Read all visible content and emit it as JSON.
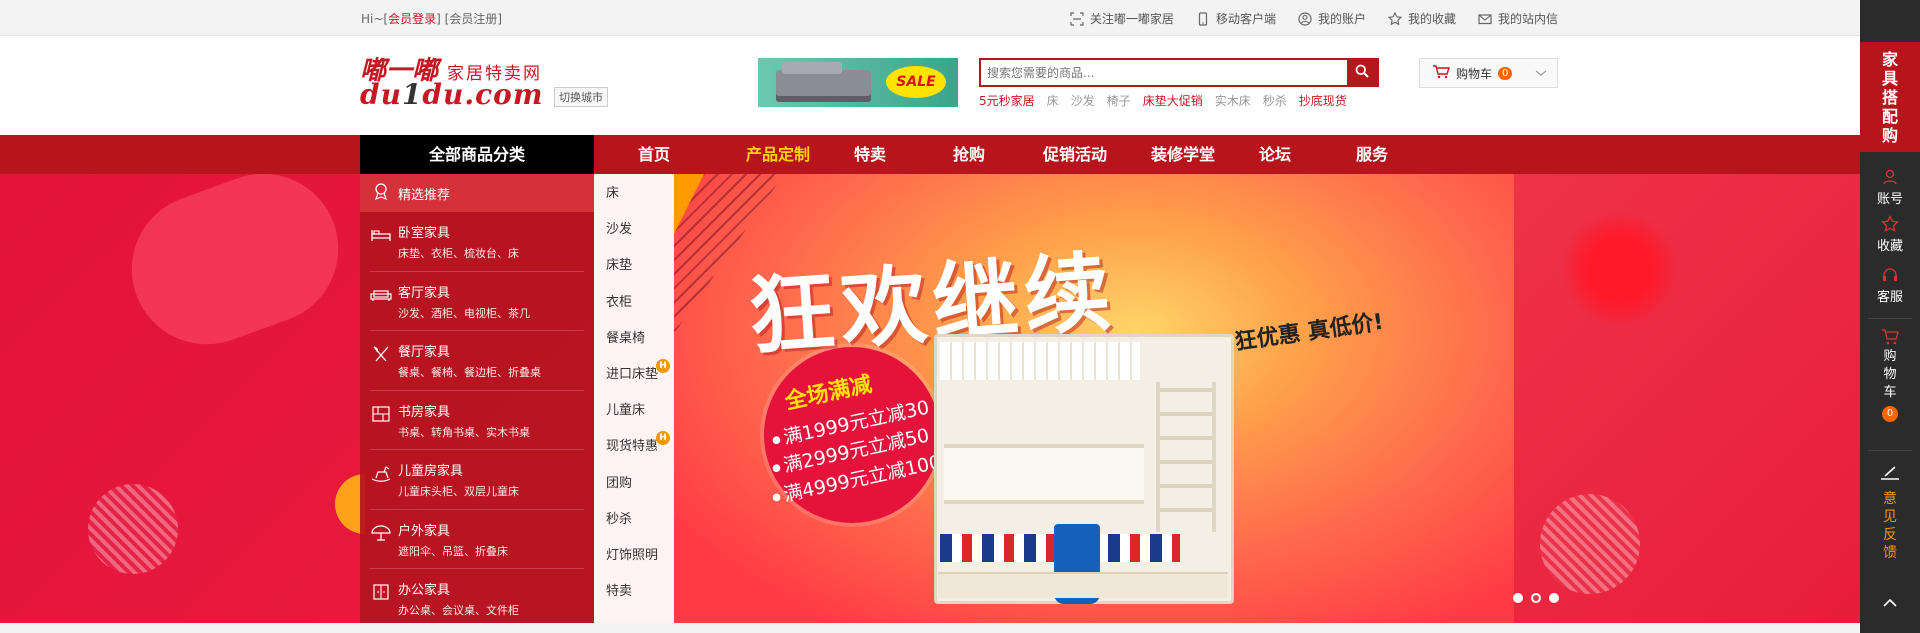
{
  "topbar": {
    "greeting": "Hi~",
    "login": "会员登录",
    "register": "会员注册",
    "links": [
      "关注嘟一嘟家居",
      "移动客户端",
      "我的账户",
      "我的收藏",
      "我的站内信"
    ]
  },
  "header": {
    "logo_cn": "嘟一嘟",
    "logo_tag": "家居特卖网",
    "logo_en_a": "du",
    "logo_en_b": "1",
    "logo_en_c": "du.com",
    "city_switch": "切换城市",
    "ad_text": "SALE",
    "search_placeholder": "搜索您需要的商品...",
    "hotwords": [
      {
        "text": "5元秒家居",
        "red": true
      },
      {
        "text": "床",
        "red": false
      },
      {
        "text": "沙发",
        "red": false
      },
      {
        "text": "椅子",
        "red": false
      },
      {
        "text": "床垫大促销",
        "red": true
      },
      {
        "text": "实木床",
        "red": false
      },
      {
        "text": "秒杀",
        "red": false
      },
      {
        "text": "抄底现货",
        "red": true
      }
    ],
    "cart_label": "购物车",
    "cart_count": "0"
  },
  "nav": {
    "all_label": "全部商品分类",
    "items": [
      {
        "label": "首页",
        "active": false
      },
      {
        "label": "产品定制",
        "active": true
      },
      {
        "label": "特卖",
        "active": false
      },
      {
        "label": "抢购",
        "active": false
      },
      {
        "label": "促销活动",
        "active": false
      },
      {
        "label": "装修学堂",
        "active": false
      },
      {
        "label": "论坛",
        "active": false
      },
      {
        "label": "服务",
        "active": false
      }
    ]
  },
  "categories": {
    "featured": "精选推荐",
    "rows": [
      {
        "title": "卧室家具",
        "sub": "床垫、衣柜、梳妆台、床",
        "icon": "bed-icon"
      },
      {
        "title": "客厅家具",
        "sub": "沙发、酒柜、电视柜、茶几",
        "icon": "sofa-icon"
      },
      {
        "title": "餐厅家具",
        "sub": "餐桌、餐椅、餐边柜、折叠桌",
        "icon": "cutlery-icon"
      },
      {
        "title": "书房家具",
        "sub": "书桌、转角书桌、实木书桌",
        "icon": "bookshelf-icon"
      },
      {
        "title": "儿童房家具",
        "sub": "儿童床头柜、双层儿童床",
        "icon": "rocking-horse-icon"
      },
      {
        "title": "户外家具",
        "sub": "遮阳伞、吊篮、折叠床",
        "icon": "umbrella-icon"
      },
      {
        "title": "办公家具",
        "sub": "办公桌、会议桌、文件柜",
        "icon": "cabinet-icon"
      }
    ]
  },
  "subcats": [
    {
      "label": "床",
      "hot": false
    },
    {
      "label": "沙发",
      "hot": false
    },
    {
      "label": "床垫",
      "hot": false
    },
    {
      "label": "衣柜",
      "hot": false
    },
    {
      "label": "餐桌椅",
      "hot": false
    },
    {
      "label": "进口床垫",
      "hot": true
    },
    {
      "label": "儿童床",
      "hot": false
    },
    {
      "label": "现货特惠",
      "hot": true
    },
    {
      "label": "团购",
      "hot": false
    },
    {
      "label": "秒杀",
      "hot": false
    },
    {
      "label": "灯饰照明",
      "hot": false
    },
    {
      "label": "特卖",
      "hot": false
    }
  ],
  "hot_badge": "H",
  "hero": {
    "title": "狂欢继续",
    "slogan": "狂优惠 真低价!",
    "circle_head": "全场满减",
    "offers": [
      "满1999元立减30",
      "满2999元立减50",
      "满4999元立减100"
    ],
    "slide_active": 1,
    "slide_count": 3
  },
  "sidebar": {
    "promo": [
      "家",
      "具",
      "搭",
      "配",
      "购"
    ],
    "account": "账号",
    "favorites": "收藏",
    "service": "客服",
    "cart": [
      "购",
      "物",
      "车"
    ],
    "cart_count": "0",
    "feedback": [
      "意",
      "见",
      "反",
      "馈"
    ]
  },
  "colors": {
    "brand_red": "#b8141b",
    "accent_yellow": "#ffd200",
    "badge_orange": "#f60"
  }
}
